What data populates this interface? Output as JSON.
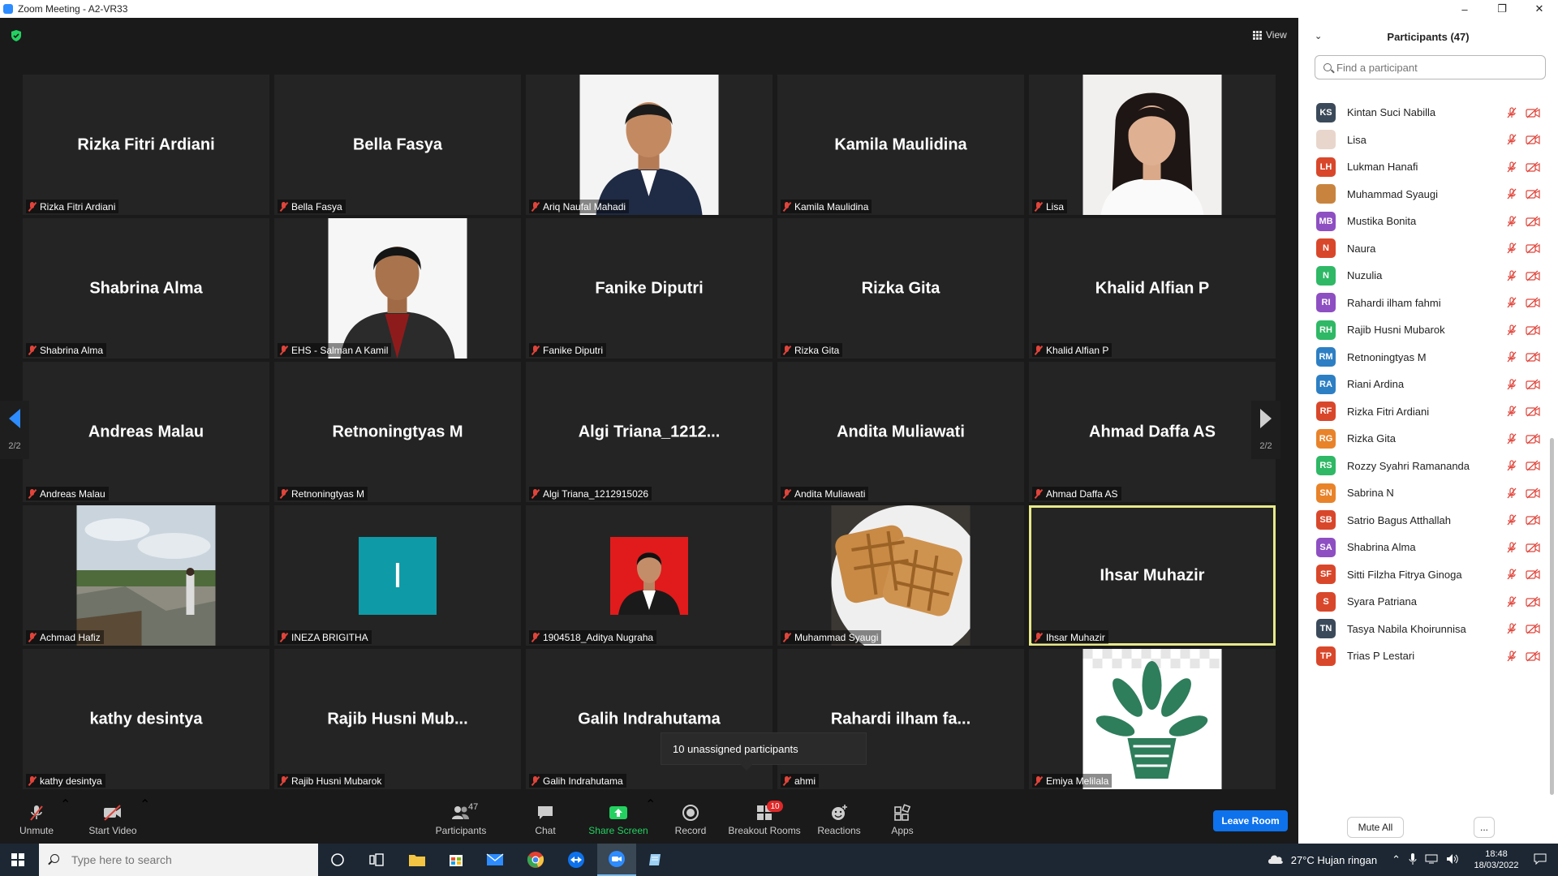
{
  "window": {
    "title": "Zoom Meeting - A2-VR33"
  },
  "view_button_label": "View",
  "grid": {
    "page_indicator_left": "2/2",
    "page_indicator_right": "2/2",
    "tiles": [
      {
        "name": "Rizka Fitri Ardiani",
        "caption": "Rizka Fitri Ardiani",
        "kind": "name"
      },
      {
        "name": "Bella Fasya",
        "caption": "Bella Fasya",
        "kind": "name"
      },
      {
        "name": "",
        "caption": "Ariq Naufal Mahadi",
        "kind": "photo-man-suit"
      },
      {
        "name": "Kamila Maulidina",
        "caption": "Kamila Maulidina",
        "kind": "name"
      },
      {
        "name": "",
        "caption": "Lisa",
        "kind": "photo-woman"
      },
      {
        "name": "Shabrina Alma",
        "caption": "Shabrina Alma",
        "kind": "name"
      },
      {
        "name": "",
        "caption": "EHS - Salman A Kamil",
        "kind": "photo-man-red"
      },
      {
        "name": "Fanike Diputri",
        "caption": "Fanike Diputri",
        "kind": "name"
      },
      {
        "name": "Rizka Gita",
        "caption": "Rizka Gita",
        "kind": "name"
      },
      {
        "name": "Khalid Alfian P",
        "caption": "Khalid Alfian P",
        "kind": "name"
      },
      {
        "name": "Andreas Malau",
        "caption": "Andreas Malau",
        "kind": "name"
      },
      {
        "name": "Retnoningtyas M",
        "caption": "Retnoningtyas M",
        "kind": "name"
      },
      {
        "name": "Algi  Triana_1212...",
        "caption": "Algi Triana_1212915026",
        "kind": "name"
      },
      {
        "name": "Andita Muliawati",
        "caption": "Andita Muliawati",
        "kind": "name"
      },
      {
        "name": "Ahmad Daffa AS",
        "caption": "Ahmad Daffa AS",
        "kind": "name"
      },
      {
        "name": "",
        "caption": "Achmad Hafiz",
        "kind": "photo-landscape"
      },
      {
        "name": "I",
        "caption": "INEZA BRIGITHA",
        "kind": "avatar"
      },
      {
        "name": "",
        "caption": "1904518_Aditya Nugraha",
        "kind": "photo-man-redbg"
      },
      {
        "name": "",
        "caption": "Muhammad Syaugi",
        "kind": "photo-waffle"
      },
      {
        "name": "Ihsar Muhazir",
        "caption": "Ihsar Muhazir",
        "kind": "name-active"
      },
      {
        "name": "kathy desintya",
        "caption": "kathy desintya",
        "kind": "name"
      },
      {
        "name": "Rajib  Husni  Mub...",
        "caption": "Rajib Husni Mubarok",
        "kind": "name"
      },
      {
        "name": "Galih Indrahutama",
        "caption": "Galih Indrahutama",
        "kind": "name"
      },
      {
        "name": "Rahardi  ilham  fa...",
        "caption": "ahmi",
        "kind": "name"
      },
      {
        "name": "",
        "caption": "Emiya Melilala",
        "kind": "photo-plant"
      }
    ]
  },
  "unassigned_popup": "10 unassigned participants",
  "toolbar": {
    "unmute": "Unmute",
    "start_video": "Start Video",
    "participants": "Participants",
    "participants_count": "47",
    "chat": "Chat",
    "share_screen": "Share Screen",
    "record": "Record",
    "breakout_rooms": "Breakout Rooms",
    "breakout_badge": "10",
    "reactions": "Reactions",
    "apps": "Apps",
    "leave_room": "Leave Room"
  },
  "panel": {
    "title": "Participants (47)",
    "search_placeholder": "Find a participant",
    "participants": [
      {
        "initials": "KS",
        "name": "Kintan Suci Nabilla",
        "color": "#3b4a5a"
      },
      {
        "initials": "",
        "name": "Lisa",
        "color": "#e8d6cc"
      },
      {
        "initials": "LH",
        "name": "Lukman Hanafi",
        "color": "#d9472b"
      },
      {
        "initials": "",
        "name": "Muhammad Syaugi",
        "color": "#c8843e"
      },
      {
        "initials": "MB",
        "name": "Mustika Bonita",
        "color": "#8e4fc2"
      },
      {
        "initials": "N",
        "name": "Naura",
        "color": "#d9472b"
      },
      {
        "initials": "N",
        "name": "Nuzulia",
        "color": "#2fb865"
      },
      {
        "initials": "RI",
        "name": "Rahardi ilham fahmi",
        "color": "#8e4fc2"
      },
      {
        "initials": "RH",
        "name": "Rajib Husni Mubarok",
        "color": "#2fb865"
      },
      {
        "initials": "RM",
        "name": "Retnoningtyas M",
        "color": "#2d7fc4"
      },
      {
        "initials": "RA",
        "name": "Riani Ardina",
        "color": "#2d7fc4"
      },
      {
        "initials": "RF",
        "name": "Rizka Fitri Ardiani",
        "color": "#d9472b"
      },
      {
        "initials": "RG",
        "name": "Rizka Gita",
        "color": "#e8832a"
      },
      {
        "initials": "RS",
        "name": "Rozzy Syahri Ramananda",
        "color": "#2fb865"
      },
      {
        "initials": "SN",
        "name": "Sabrina N",
        "color": "#e8832a"
      },
      {
        "initials": "SB",
        "name": "Satrio Bagus Atthallah",
        "color": "#d9472b"
      },
      {
        "initials": "SA",
        "name": "Shabrina Alma",
        "color": "#8e4fc2"
      },
      {
        "initials": "SF",
        "name": "Sitti Filzha Fitrya Ginoga",
        "color": "#d9472b"
      },
      {
        "initials": "S",
        "name": "Syara Patriana",
        "color": "#d9472b"
      },
      {
        "initials": "TN",
        "name": "Tasya Nabila Khoirunnisa",
        "color": "#3b4a5a"
      },
      {
        "initials": "TP",
        "name": "Trias P Lestari",
        "color": "#d9472b"
      }
    ],
    "mute_all": "Mute All",
    "more": "..."
  },
  "taskbar": {
    "search_placeholder": "Type here to search",
    "weather": "27°C  Hujan ringan",
    "time": "18:48",
    "date": "18/03/2022"
  }
}
